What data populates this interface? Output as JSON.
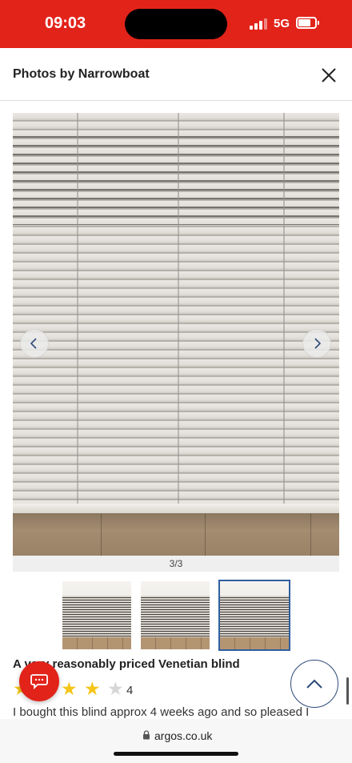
{
  "status_bar": {
    "time": "09:03",
    "network": "5G",
    "background_color": "#e2231a"
  },
  "modal": {
    "title": "Photos by Narrowboat",
    "close_icon": "close-icon"
  },
  "gallery": {
    "counter": "3/3",
    "prev_icon": "chevron-left-icon",
    "next_icon": "chevron-right-icon",
    "thumbnails": [
      {
        "name": "thumbnail-1",
        "active": false
      },
      {
        "name": "thumbnail-2",
        "active": false
      },
      {
        "name": "thumbnail-3",
        "active": true
      }
    ],
    "active_border_color": "#2f5fa0"
  },
  "review": {
    "title": "A very reasonably priced Venetian blind",
    "rating": 4,
    "rating_max": 5,
    "rating_label": "4",
    "body": "I bought this blind approx 4 weeks ago and so pleased I",
    "star_color": "#f5c518"
  },
  "floating": {
    "chat_icon": "chat-icon",
    "scroll_top_icon": "chevron-up-icon"
  },
  "browser": {
    "url": "argos.co.uk",
    "lock_icon": "lock-icon"
  }
}
